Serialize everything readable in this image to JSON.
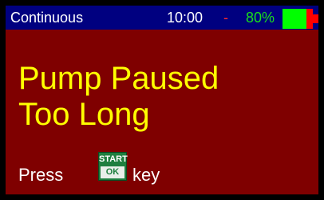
{
  "status_bar": {
    "mode": "Continuous",
    "time": "10:00",
    "separator": "-",
    "battery_percent": "80%",
    "battery_level": 0.8,
    "battery_icon": "battery-icon"
  },
  "alarm": {
    "title_line1": "Pump Paused",
    "title_line2": "Too Long"
  },
  "instruction": {
    "before": "Press",
    "key_top": "START",
    "key_bottom": "OK",
    "key_icon": "start-ok-key-icon",
    "after": "key"
  },
  "colors": {
    "screen_background": "#7f0000",
    "status_bar_background": "#000080",
    "title_text": "#ffff00",
    "body_text": "#ffffff",
    "separator": "#ff2a2a",
    "battery_text": "#1adf1a",
    "battery_charged": "#00ff00",
    "battery_empty": "#ff0000",
    "key_green": "#1f7f3f"
  }
}
